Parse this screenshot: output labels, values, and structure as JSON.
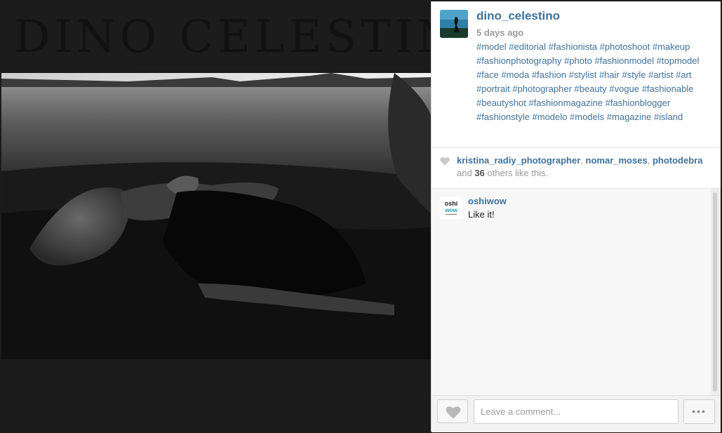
{
  "background": {
    "wordmark": "DINO CELESTINO"
  },
  "post": {
    "username": "dino_celestino",
    "time_ago": "5 days ago",
    "hashtags": [
      "#model",
      "#editorial",
      "#fashionista",
      "#photoshoot",
      "#makeup",
      "#fashionphotography",
      "#photo",
      "#fashionmodel",
      "#topmodel",
      "#face",
      "#moda",
      "#fashion",
      "#stylist",
      "#hair",
      "#style",
      "#artist",
      "#art",
      "#portrait",
      "#photographer",
      "#beauty",
      "#vogue",
      "#fashionable",
      "#beautyshot",
      "#fashionmagazine",
      "#fashionblogger",
      "#fashionstyle",
      "#modelo",
      "#models",
      "#magazine",
      "#island"
    ]
  },
  "likes": {
    "users": [
      "kristina_radiy_photographer",
      "nomar_moses",
      "photodebra"
    ],
    "separator": ",",
    "prefix": "and",
    "others_count": "36",
    "suffix": "others like this."
  },
  "comments": [
    {
      "username": "oshiwow",
      "text": "Like it!",
      "avatar_text": [
        "oshi",
        "wow"
      ]
    }
  ],
  "footer": {
    "comment_placeholder": "Leave a comment...",
    "more_label": "•••"
  },
  "colors": {
    "link": "#3f729b",
    "muted": "#9a9a9a",
    "backdrop": "#1c1c1c"
  },
  "icons": {
    "like": "heart-icon",
    "more": "ellipsis-icon"
  }
}
